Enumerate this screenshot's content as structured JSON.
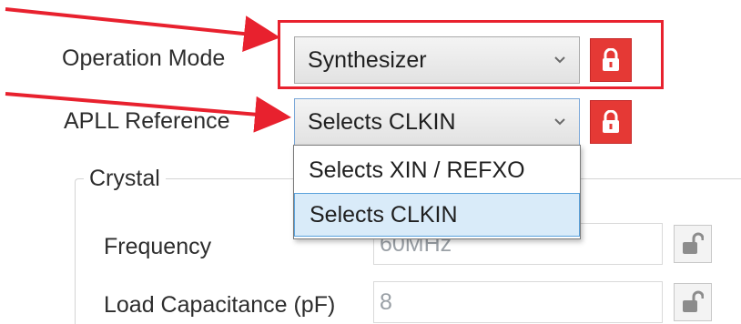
{
  "form": {
    "operation_mode_label": "Operation Mode",
    "operation_mode_value": "Synthesizer",
    "apll_reference_label": "APLL Reference",
    "apll_reference_value": "Selects CLKIN",
    "apll_reference_options": [
      "Selects XIN / REFXO",
      "Selects CLKIN"
    ],
    "apll_reference_selected_index": 1
  },
  "crystal": {
    "group_title": "Crystal",
    "frequency_label": "Frequency",
    "frequency_value": "60MHz",
    "load_capacitance_label": "Load Capacitance (pF)",
    "load_capacitance_value": "8"
  },
  "colors": {
    "annotation_red": "#e8212e",
    "lock_red": "#e53935",
    "selection_blue": "#d9ebf9"
  },
  "icons": {
    "locked": "lock-icon",
    "unlocked": "unlock-icon",
    "dropdown": "chevron-down-icon",
    "annotation": "arrow-icon"
  }
}
